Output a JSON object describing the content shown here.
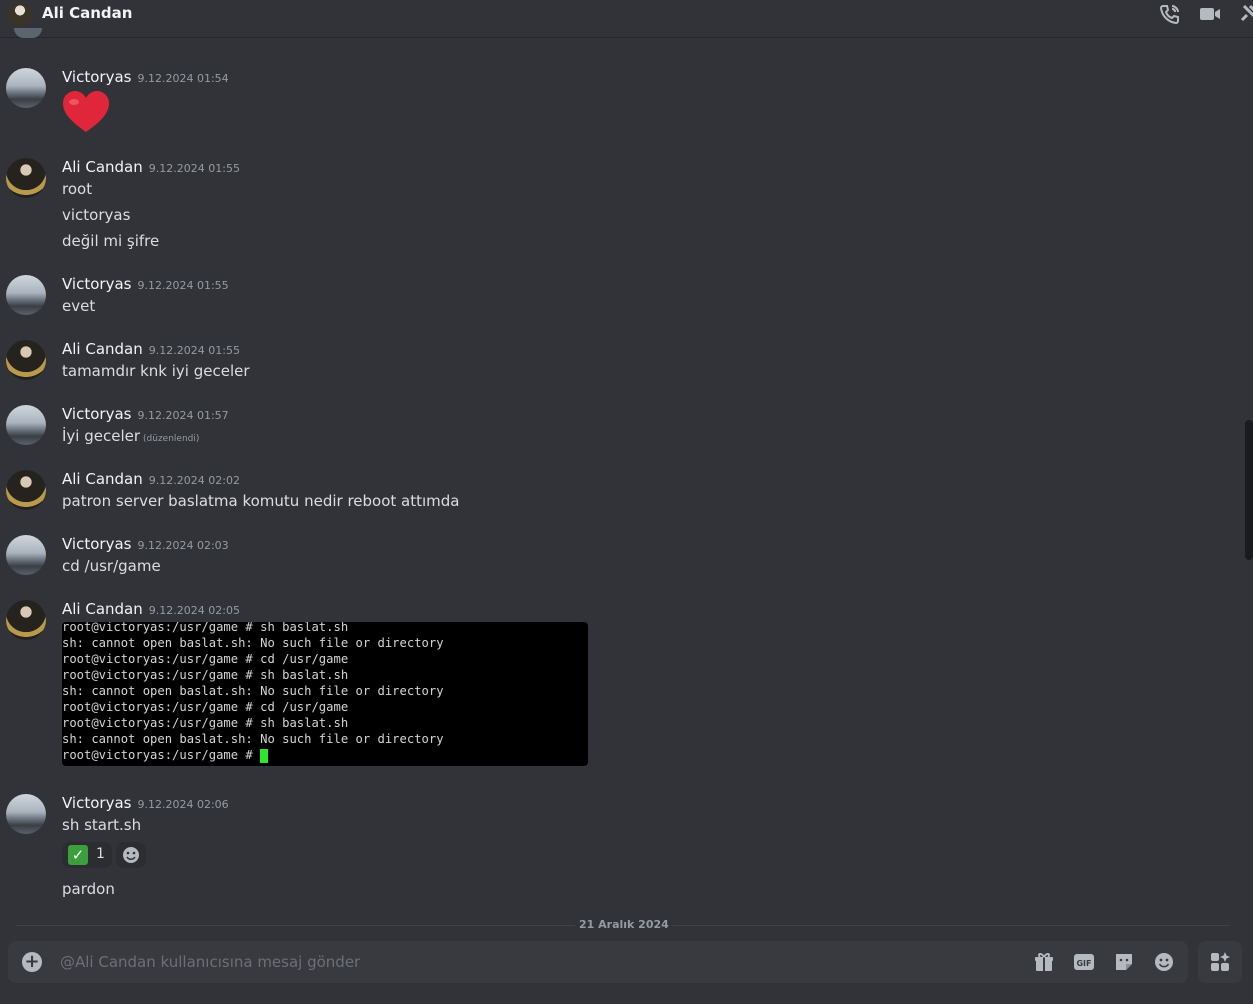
{
  "header": {
    "title": "Ali Candan",
    "icons": [
      "voice-call-icon",
      "video-call-icon",
      "pin-icon"
    ]
  },
  "messages": [
    {
      "author": "Victoryas",
      "timestamp": "9.12.2024 01:54",
      "lines": [],
      "emoji": "red-heart"
    },
    {
      "author": "Ali Candan",
      "timestamp": "9.12.2024 01:55",
      "lines": [
        "root",
        "victoryas",
        "değil mi şifre"
      ]
    },
    {
      "author": "Victoryas",
      "timestamp": "9.12.2024 01:55",
      "lines": [
        "evet"
      ]
    },
    {
      "author": "Ali Candan",
      "timestamp": "9.12.2024 01:55",
      "lines": [
        "tamamdır knk iyi geceler"
      ]
    },
    {
      "author": "Victoryas",
      "timestamp": "9.12.2024 01:57",
      "lines": [
        "İyi geceler"
      ],
      "edited": "(düzenlendi)"
    },
    {
      "author": "Ali Candan",
      "timestamp": "9.12.2024 02:02",
      "lines": [
        "patron server baslatma komutu nedir reboot attımda"
      ]
    },
    {
      "author": "Victoryas",
      "timestamp": "9.12.2024 02:03",
      "lines": [
        "cd /usr/game"
      ]
    },
    {
      "author": "Ali Candan",
      "timestamp": "9.12.2024 02:05",
      "lines": []
    },
    {
      "author": "Victoryas",
      "timestamp": "9.12.2024 02:06",
      "lines": [
        "sh start.sh",
        "pardon"
      ]
    }
  ],
  "terminal": {
    "lines": [
      "root@victoryas:/usr/game # sh baslat.sh",
      "sh: cannot open baslat.sh: No such file or directory",
      "root@victoryas:/usr/game # cd /usr/game",
      "root@victoryas:/usr/game # sh baslat.sh",
      "sh: cannot open baslat.sh: No such file or directory",
      "root@victoryas:/usr/game # cd /usr/game",
      "root@victoryas:/usr/game # sh baslat.sh",
      "sh: cannot open baslat.sh: No such file or directory",
      "root@victoryas:/usr/game # "
    ]
  },
  "reaction": {
    "emoji": "white-check-mark",
    "count": "1"
  },
  "divider": {
    "label": "21 Aralık 2024"
  },
  "composer": {
    "placeholder": "@Ali Candan kullanıcısına mesaj gönder",
    "icons": [
      "gift-icon",
      "gif-icon",
      "sticker-icon",
      "emoji-icon",
      "apps-icon"
    ]
  },
  "colors": {
    "background": "#313338",
    "composer": "#383a40",
    "cursor": "#2ee82e",
    "heart": "#e0263a"
  }
}
